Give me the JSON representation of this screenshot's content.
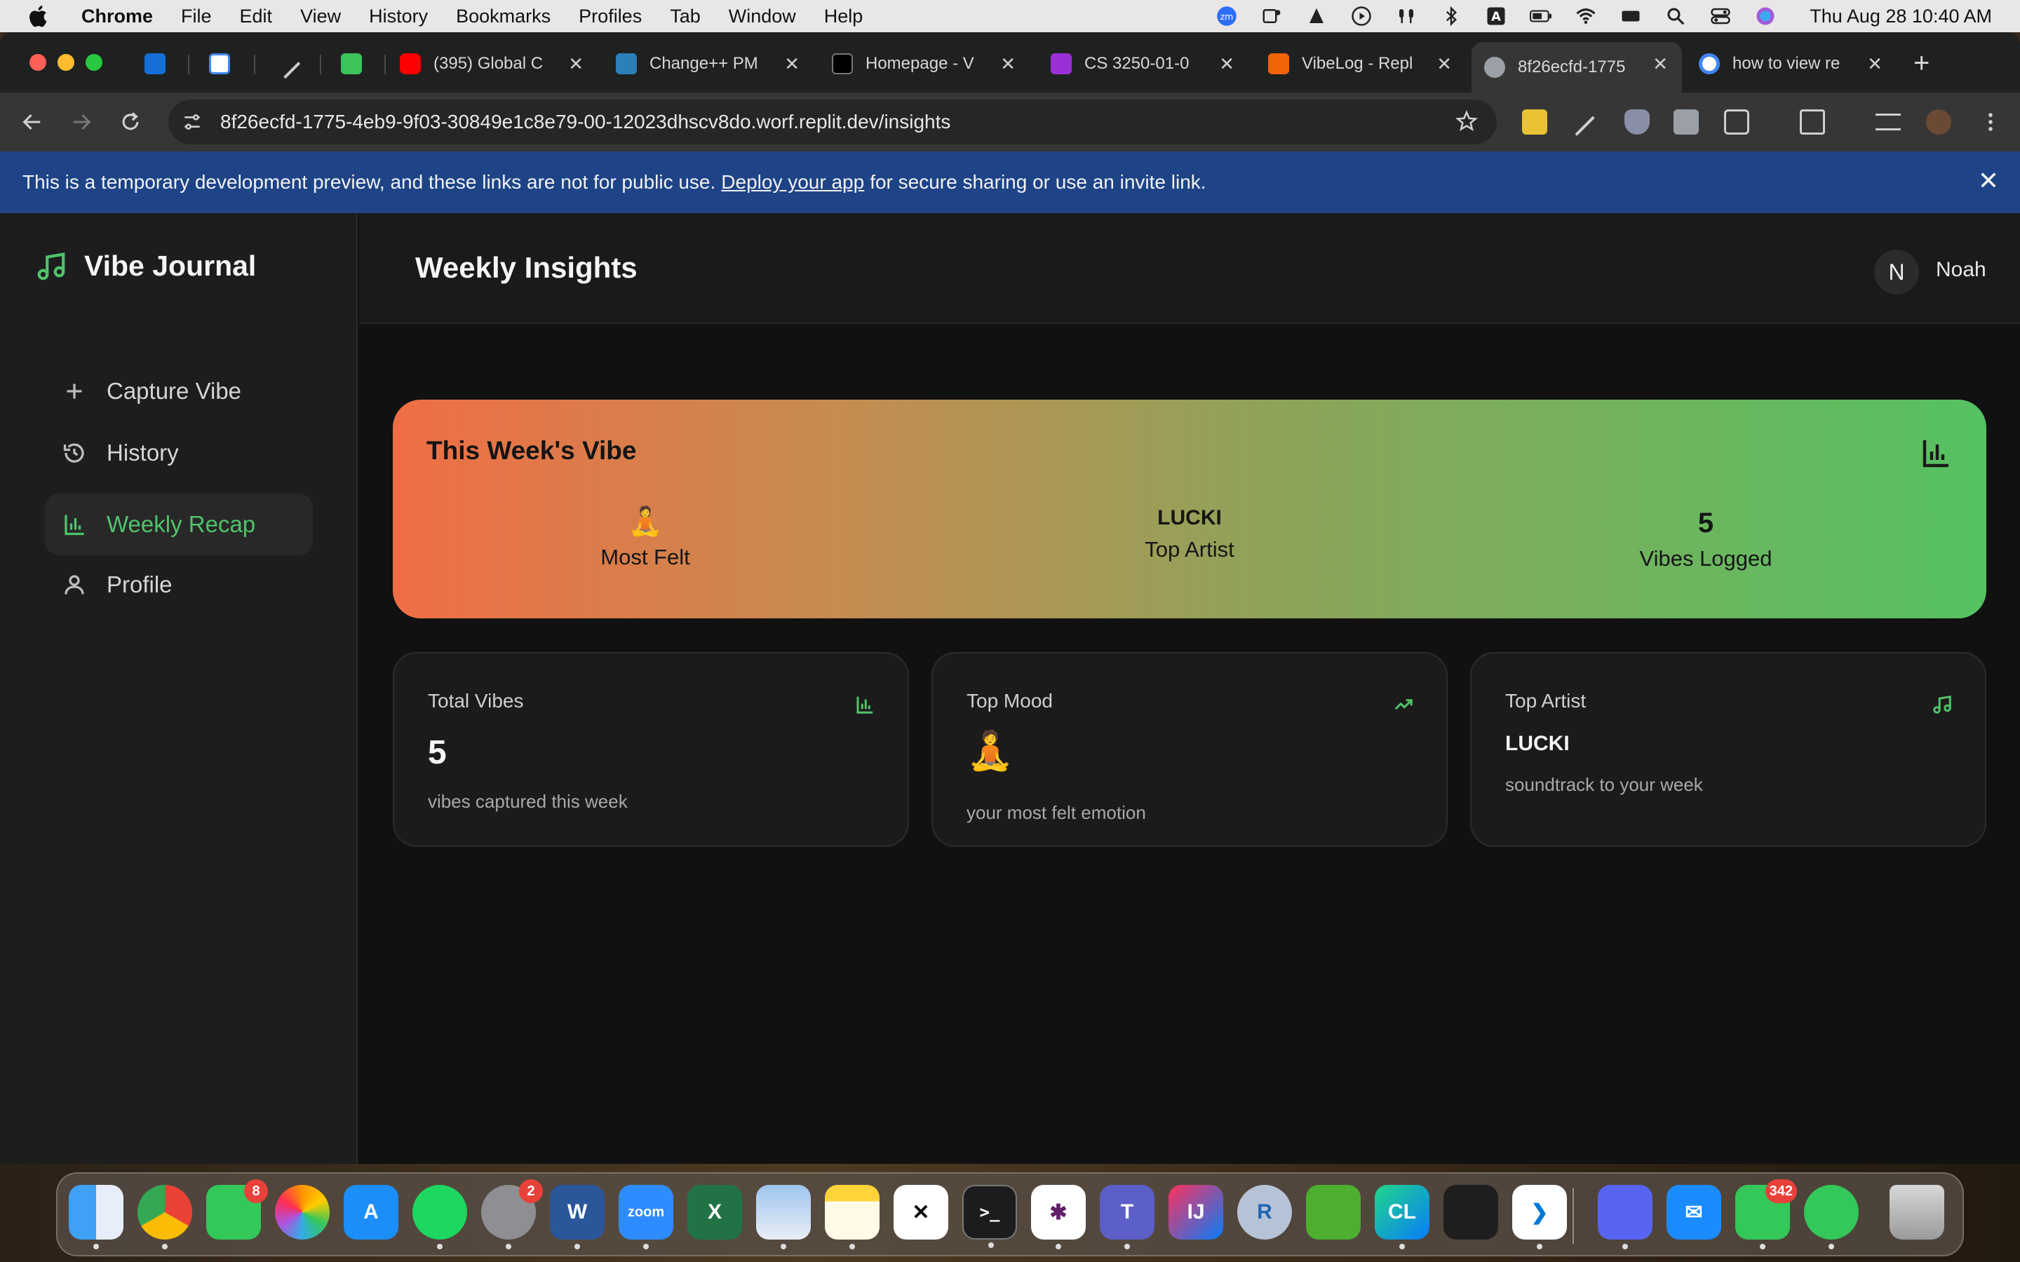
{
  "menubar": {
    "app_name": "Chrome",
    "menus": [
      "File",
      "Edit",
      "View",
      "History",
      "Bookmarks",
      "Profiles",
      "Tab",
      "Window",
      "Help"
    ],
    "clock": "Thu Aug 28  10:40 AM"
  },
  "browser": {
    "tabs": [
      {
        "label": "",
        "favicon": "outlook-icon",
        "color": "#1470d6"
      },
      {
        "label": "",
        "favicon": "calendar-icon",
        "color": "#ffffff"
      },
      {
        "label": "",
        "favicon": "pen-icon",
        "color": "#cccccc"
      },
      {
        "label": "",
        "favicon": "slash-app-icon",
        "color": "#3cc35b"
      },
      {
        "label": "(395) Global C",
        "favicon": "youtube-icon",
        "color": "#ff0000"
      },
      {
        "label": "Change++ PM",
        "favicon": "change-icon",
        "color": "#2d7fb8"
      },
      {
        "label": "Homepage - V",
        "favicon": "d2l-icon",
        "color": "#000000"
      },
      {
        "label": "CS 3250-01-0",
        "favicon": "t-icon",
        "color": "#9b30d9"
      },
      {
        "label": "VibeLog - Repl",
        "favicon": "replit-icon",
        "color": "#f26207"
      },
      {
        "label": "8f26ecfd-1775",
        "favicon": "globe-icon",
        "color": "#9aa0a6"
      },
      {
        "label": "how to view re",
        "favicon": "google-icon",
        "color": "#4285f4"
      }
    ],
    "url": "8f26ecfd-1775-4eb9-9f03-30849e1c8e79-00-12023dhscv8do.worf.replit.dev/insights"
  },
  "banner": {
    "text_before": "This is a temporary development preview, and these links are not for public use.",
    "link": "Deploy your app",
    "text_after": "for secure sharing or use an invite link."
  },
  "sidebar": {
    "brand": "Vibe Journal",
    "items": [
      {
        "label": "Capture Vibe",
        "icon": "plus-icon"
      },
      {
        "label": "History",
        "icon": "history-icon"
      },
      {
        "label": "Weekly Recap",
        "icon": "bar-chart-icon"
      },
      {
        "label": "Profile",
        "icon": "user-icon"
      }
    ]
  },
  "header": {
    "title": "Weekly Insights",
    "avatar_initial": "N",
    "username": "Noah"
  },
  "hero": {
    "title": "This Week's Vibe",
    "stats": [
      {
        "value": "🧘",
        "label": "Most Felt"
      },
      {
        "value": "LUCKI",
        "label": "Top Artist"
      },
      {
        "value": "5",
        "label": "Vibes Logged"
      }
    ]
  },
  "cards": [
    {
      "title": "Total Vibes",
      "value": "5",
      "subtitle": "vibes captured this week",
      "icon": "bar-chart-icon"
    },
    {
      "title": "Top Mood",
      "value": "🧘",
      "subtitle": "your most felt emotion",
      "icon": "trending-up-icon"
    },
    {
      "title": "Top Artist",
      "value": "LUCKI",
      "subtitle": "soundtrack to your week",
      "icon": "music-note-icon"
    }
  ],
  "dock": {
    "facetime_badge": "8",
    "settings_badge": "2",
    "messages_badge": "342",
    "zoom_label": "zoom",
    "terminal_label": ">_",
    "intellij_label": "IJ",
    "clion_label": "CL",
    "r_label": "R"
  },
  "colors": {
    "accent": "#4fc46a",
    "banner": "#1e4487",
    "hero_start": "#ef6e45",
    "hero_end": "#55c262"
  }
}
